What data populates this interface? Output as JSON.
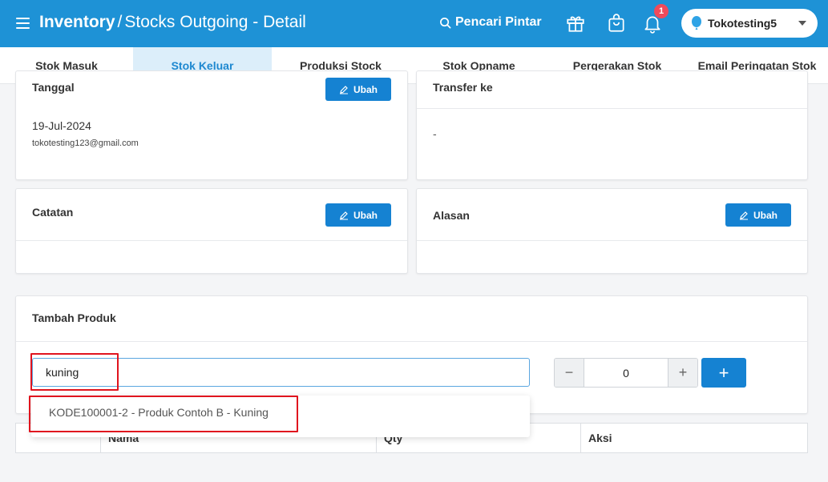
{
  "header": {
    "title_strong": "Inventory",
    "separator": "/",
    "title_rest": "Stocks Outgoing - Detail",
    "smart_search_label": "Pencari Pintar",
    "notification_count": "1",
    "store_name": "Tokotesting5"
  },
  "tabs": [
    {
      "label": "Stok Masuk",
      "active": false
    },
    {
      "label": "Stok Keluar",
      "active": true
    },
    {
      "label": "Produksi Stock",
      "active": false
    },
    {
      "label": "Stok Opname",
      "active": false
    },
    {
      "label": "Pergerakan Stok",
      "active": false
    },
    {
      "label": "Email Peringatan Stok",
      "active": false
    }
  ],
  "date_card": {
    "label": "Tanggal",
    "button_label": "Ubah",
    "date": "19-Jul-2024",
    "email": "tokotesting123@gmail.com"
  },
  "transfer_card": {
    "label": "Transfer ke",
    "value": "-"
  },
  "note_card": {
    "label": "Catatan",
    "button_label": "Ubah"
  },
  "reason_card": {
    "label": "Alasan",
    "button_label": "Ubah"
  },
  "add_product": {
    "label": "Tambah Produk",
    "search_value": "kuning",
    "quantity": "0",
    "minus": "−",
    "plus": "+",
    "add_button": "+",
    "suggestion": "KODE100001-2 - Produk Contoh B - Kuning"
  },
  "table": {
    "columns": [
      "",
      "Nama",
      "Qty",
      "Aksi"
    ]
  },
  "colors": {
    "primary": "#1e92d6",
    "button": "#1582d2",
    "highlight": "#e0141e",
    "badge": "#ef4a5b"
  }
}
